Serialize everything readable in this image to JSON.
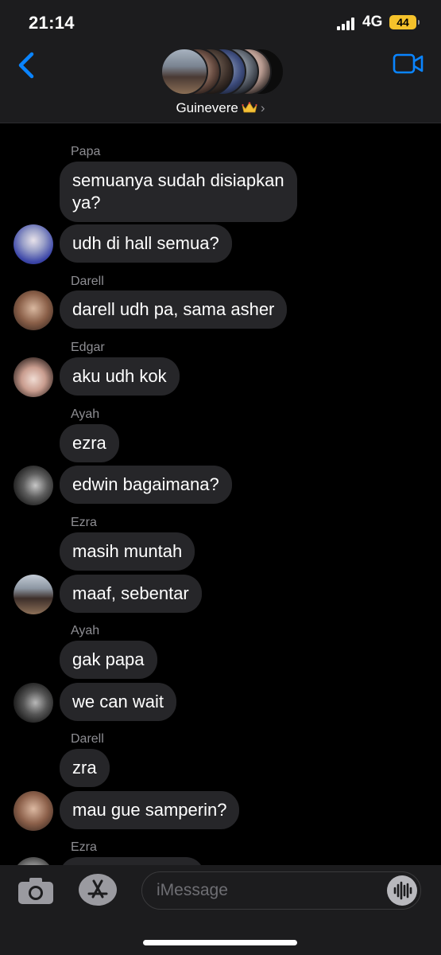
{
  "status_bar": {
    "time": "21:14",
    "network": "4G",
    "battery": "44"
  },
  "header": {
    "back_icon": "chevron-left-icon",
    "video_icon": "video-camera-icon",
    "group_name": "Guinevere",
    "group_emoji": "crown-icon",
    "chevron": "›",
    "accent_color": "#0a84ff"
  },
  "messages": [
    {
      "sender": "Papa",
      "text": "semuanya sudah disiapkan\nya?",
      "avatar": false
    },
    {
      "sender": "",
      "text": "udh di hall semua?",
      "avatar": true
    },
    {
      "sender": "Darell",
      "text": "darell udh pa, sama asher",
      "avatar": true
    },
    {
      "sender": "Edgar",
      "text": "aku udh kok",
      "avatar": true
    },
    {
      "sender": "Ayah",
      "text": "ezra",
      "avatar": false
    },
    {
      "sender": "",
      "text": "edwin bagaimana?",
      "avatar": true
    },
    {
      "sender": "Ezra",
      "text": "masih muntah",
      "avatar": false
    },
    {
      "sender": "",
      "text": "maaf, sebentar",
      "avatar": true
    },
    {
      "sender": "Ayah",
      "text": "gak papa",
      "avatar": false
    },
    {
      "sender": "",
      "text": "we can wait",
      "avatar": true
    },
    {
      "sender": "Darell",
      "text": "zra",
      "avatar": false
    },
    {
      "sender": "",
      "text": "mau gue samperin?",
      "avatar": true
    },
    {
      "sender": "Ezra",
      "text": "",
      "avatar": true
    }
  ],
  "input_bar": {
    "camera_icon": "camera-icon",
    "appstore_icon": "app-store-icon",
    "placeholder": "iMessage",
    "audio_icon": "audio-waveform-icon"
  }
}
